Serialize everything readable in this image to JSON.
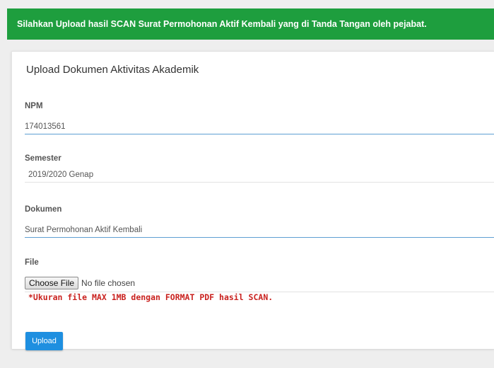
{
  "alert": {
    "message": "Silahkan Upload hasil SCAN Surat Permohonan Aktif Kembali yang di Tanda Tangan oleh pejabat."
  },
  "form": {
    "title": "Upload Dokumen Aktivitas Akademik",
    "npm": {
      "label": "NPM",
      "value": "174013561"
    },
    "semester": {
      "label": "Semester",
      "value": "2019/2020 Genap"
    },
    "dokumen": {
      "label": "Dokumen",
      "value": "Surat Permohonan Aktif Kembali"
    },
    "file": {
      "label": "File",
      "button_label": "Choose File",
      "status": "No file chosen",
      "note": "*Ukuran file MAX 1MB dengan FORMAT PDF hasil SCAN."
    },
    "submit_label": "Upload"
  },
  "colors": {
    "alert_bg": "#1e9e3e",
    "primary_button": "#1e8fe0",
    "note_text": "#c9211e",
    "focus_underline": "#5e9fd3"
  }
}
